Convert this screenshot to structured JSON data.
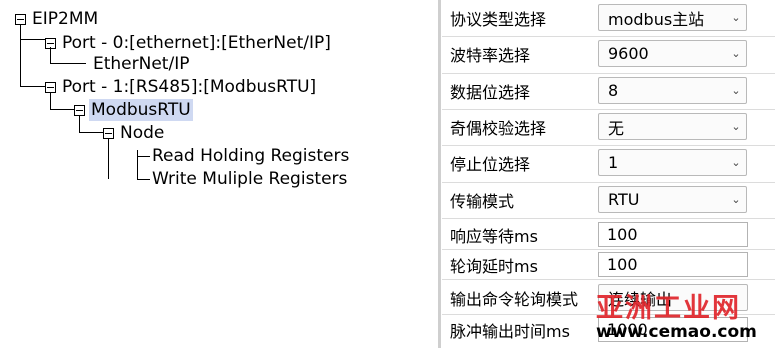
{
  "tree": {
    "root": "EIP2MM",
    "port0": "Port - 0:[ethernet]:[EtherNet/IP]",
    "port0_child": "EtherNet/IP",
    "port1": "Port - 1:[RS485]:[ModbusRTU]",
    "port1_child": "ModbusRTU",
    "node": "Node",
    "cmd1": "Read Holding Registers",
    "cmd2": "Write Muliple Registers"
  },
  "settings": {
    "protocol": {
      "label": "协议类型选择",
      "value": "modbus主站"
    },
    "baud": {
      "label": "波特率选择",
      "value": "9600"
    },
    "databits": {
      "label": "数据位选择",
      "value": "8"
    },
    "parity": {
      "label": "奇偶校验选择",
      "value": "无"
    },
    "stopbits": {
      "label": "停止位选择",
      "value": "1"
    },
    "mode": {
      "label": "传输模式",
      "value": "RTU"
    },
    "timeout": {
      "label": "响应等待ms",
      "value": "100"
    },
    "poll_delay": {
      "label": "轮询延时ms",
      "value": "100"
    },
    "output_mode": {
      "label": "输出命令轮询模式",
      "value": "连续输出"
    },
    "pulse_time": {
      "label": "脉冲输出时间ms",
      "value": "1000"
    }
  },
  "watermark": {
    "line1": "亚洲工业网",
    "line2": "www.cemao.com"
  }
}
